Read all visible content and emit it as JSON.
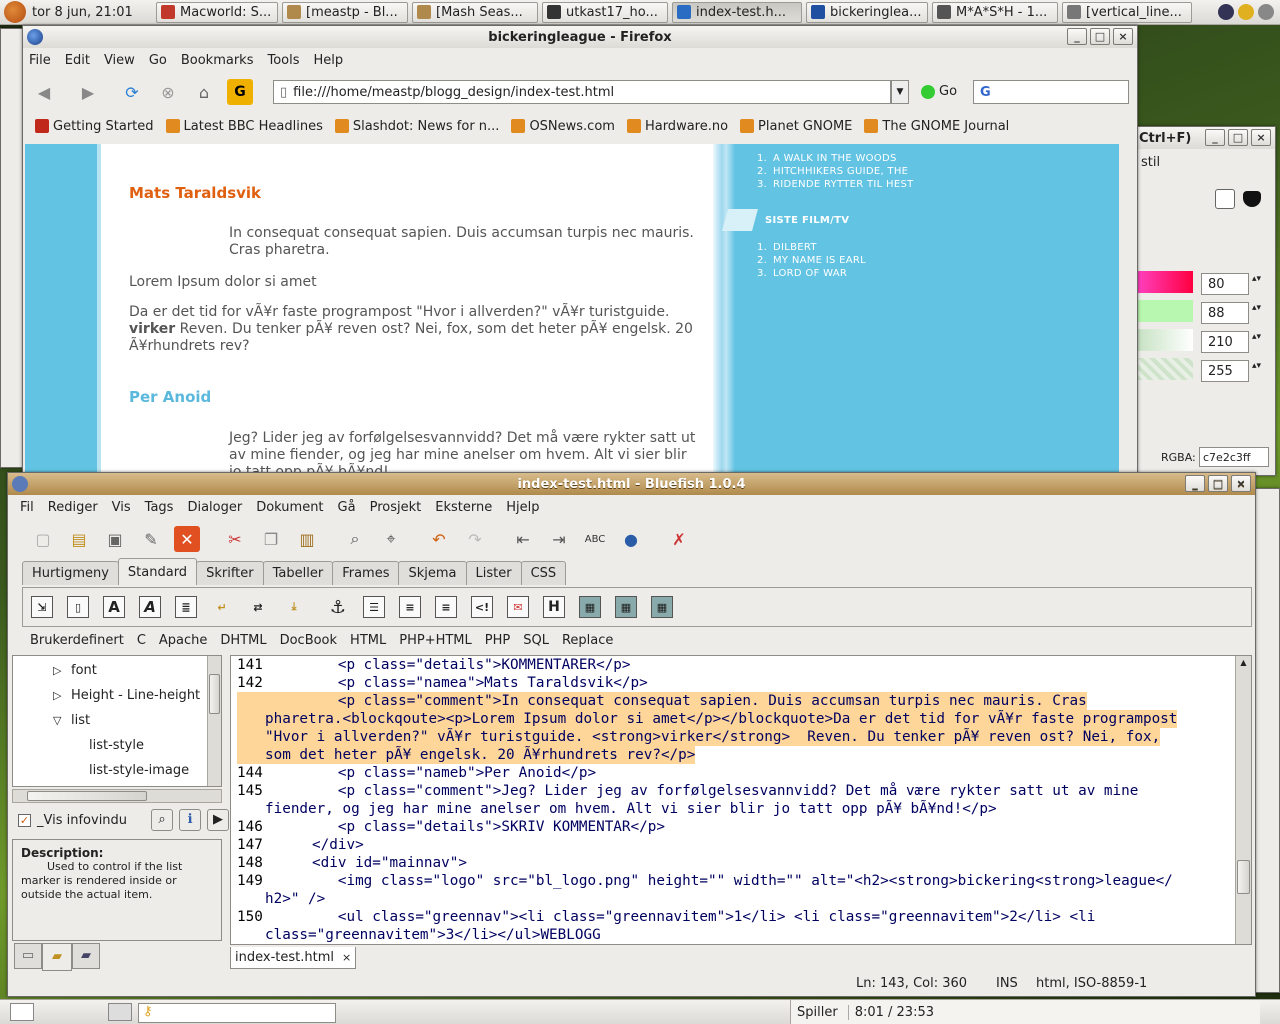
{
  "top_panel": {
    "clock": "tor  8 jun, 21:01",
    "tasks": [
      {
        "label": "Macworld: S...",
        "color": "#c0392b"
      },
      {
        "label": "[meastp - Bl...",
        "color": "#b08a4c"
      },
      {
        "label": "[Mash Seas...",
        "color": "#b08a4c"
      },
      {
        "label": "utkast17_ho...",
        "color": "#333333"
      },
      {
        "label": "index-test.h...",
        "color": "#2a6cc4"
      },
      {
        "label": "bickeringlea...",
        "color": "#1f4fa0"
      },
      {
        "label": "M*A*S*H - 1...",
        "color": "#555555"
      },
      {
        "label": "[vertical_line...",
        "color": "#777777"
      }
    ]
  },
  "firefox": {
    "title": "bickeringleague - Firefox",
    "menu": [
      "File",
      "Edit",
      "View",
      "Go",
      "Bookmarks",
      "Tools",
      "Help"
    ],
    "url": "file:///home/meastp/blogg_design/index-test.html",
    "go_label": "Go",
    "bookmarks": [
      "Getting Started",
      "Latest BBC Headlines",
      "Slashdot: News for n...",
      "OSNews.com",
      "Hardware.no",
      "Planet GNOME",
      "The GNOME Journal"
    ],
    "page": {
      "comment1_name": "Mats Taraldsvik",
      "comment1_quote": "In consequat consequat sapien. Duis accumsan turpis nec mauris. Cras pharetra.",
      "comment1_p1": "Lorem Ipsum dolor si amet",
      "comment1_p2_a": "Da er det tid for vÃ¥r faste programpost \"Hvor i allverden?\" vÃ¥r turistguide.",
      "comment1_p2_strong": "virker",
      "comment1_p2_b": " Reven. Du tenker pÃ¥ reven ost? Nei, fox, som det heter pÃ¥ engelsk. 20 Ã¥rhundrets rev?",
      "comment2_name": "Per Anoid",
      "comment2_text": "Jeg? Lider jeg av forfølgelsesvannvidd? Det må være rykter satt ut av mine fiender, og jeg har mine anelser om hvem. Alt vi sier blir jo tatt opp pÃ¥ bÃ¥nd!",
      "books": [
        "A WALK IN THE WOODS",
        "HITCHHIKERS GUIDE, THE",
        "RIDENDE RYTTER TIL HEST"
      ],
      "films_heading": "SISTE FILM/TV",
      "films": [
        "DILBERT",
        "MY NAME IS EARL",
        "LORD OF WAR"
      ]
    }
  },
  "colorpicker": {
    "title_fragment": "Ctrl+F)",
    "tab_fragment": "stil",
    "values": [
      "80",
      "88",
      "210",
      "255"
    ],
    "rgba_label": "RGBA:",
    "rgba_value": "c7e2c3ff"
  },
  "bluefish": {
    "title": "index-test.html - Bluefish 1.0.4",
    "menu": [
      "Fil",
      "Rediger",
      "Vis",
      "Tags",
      "Dialoger",
      "Dokument",
      "Gå",
      "Prosjekt",
      "Eksterne",
      "Hjelp"
    ],
    "tabs": [
      "Hurtigmeny",
      "Standard",
      "Skrifter",
      "Tabeller",
      "Frames",
      "Skjema",
      "Lister",
      "CSS"
    ],
    "selected_tab": "Standard",
    "custom_menus": [
      "Brukerdefinert",
      "C",
      "Apache",
      "DHTML",
      "DocBook",
      "HTML",
      "PHP+HTML",
      "PHP",
      "SQL",
      "Replace"
    ],
    "tree": [
      "font",
      "Height - Line-height",
      "list",
      "list-style",
      "list-style-image"
    ],
    "show_info_label": "_Vis infovindu",
    "description_title": "Description:",
    "description_text": "Used to control if the list marker is rendered inside or outside the actual item.",
    "document_tab": "index-test.html",
    "status": {
      "position": "Ln: 143, Col: 360",
      "mode": "INS",
      "encoding": "html, ISO-8859-1"
    },
    "code_lines": [
      {
        "n": "141",
        "text": "        <p class=\"details\">KOMMENTARER</p>"
      },
      {
        "n": "142",
        "text": "        <p class=\"namea\">Mats Taraldsvik</p>"
      },
      {
        "n": "143",
        "text": "        <p class=\"comment\">In consequat consequat sapien. Duis accumsan turpis nec mauris. Cras"
      },
      {
        "n": "",
        "text": "pharetra.<blockqoute><p>Lorem Ipsum dolor si amet</p></blockquote>Da er det tid for vÃ¥r faste programpost"
      },
      {
        "n": "",
        "text": "\"Hvor i allverden?\" vÃ¥r turistguide. <strong>virker</strong>  Reven. Du tenker pÃ¥ reven ost? Nei, fox,"
      },
      {
        "n": "",
        "text": "som det heter pÃ¥ engelsk. 20 Ã¥rhundrets rev?</p>"
      },
      {
        "n": "144",
        "text": "        <p class=\"nameb\">Per Anoid</p>"
      },
      {
        "n": "145",
        "text": "        <p class=\"comment\">Jeg? Lider jeg av forfølgelsesvannvidd? Det må være rykter satt ut av mine"
      },
      {
        "n": "",
        "text": "fiender, og jeg har mine anelser om hvem. Alt vi sier blir jo tatt opp pÃ¥ bÃ¥nd!</p>"
      },
      {
        "n": "146",
        "text": "        <p class=\"details\">SKRIV KOMMENTAR</p>"
      },
      {
        "n": "147",
        "text": "     </div>"
      },
      {
        "n": "148",
        "text": "     <div id=\"mainnav\">"
      },
      {
        "n": "149",
        "text": "        <img class=\"logo\" src=\"bl_logo.png\" height=\"\" width=\"\" alt=\"<h2><strong>bickering<strong>league</"
      },
      {
        "n": "",
        "text": "h2>\" />"
      },
      {
        "n": "150",
        "text": "        <ul class=\"greennav\"><li class=\"greennavitem\">1</li> <li class=\"greennavitem\">2</li> <li"
      },
      {
        "n": "",
        "text": "class=\"greennavitem\">3</li></ul>WEBLOGG"
      }
    ]
  },
  "bottom_panel": {
    "player_label": "Spiller",
    "player_time": "8:01 / 23:53"
  }
}
